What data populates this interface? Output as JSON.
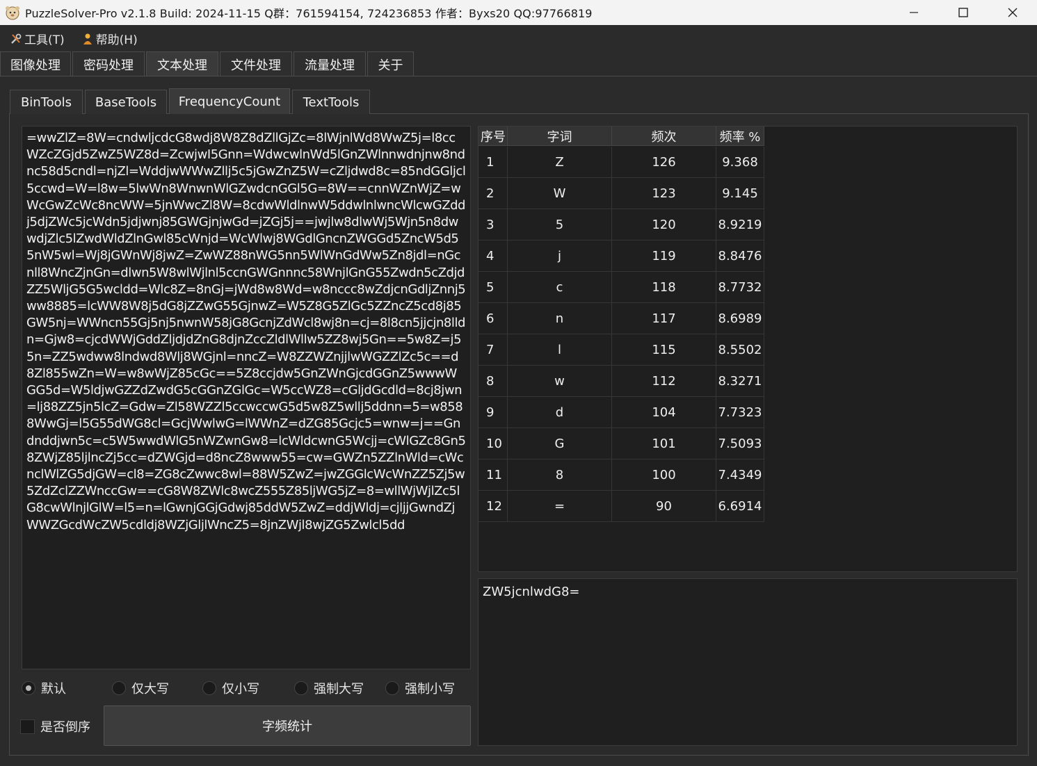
{
  "window": {
    "title": "PuzzleSolver-Pro v2.1.8  Build: 2024-11-15  Q群：761594154, 724236853  作者：Byxs20  QQ:97766819"
  },
  "menu": [
    {
      "label": "工具(T)",
      "icon": "tools-icon"
    },
    {
      "label": "帮助(H)",
      "icon": "help-person-icon"
    }
  ],
  "main_tabs": [
    {
      "label": "图像处理",
      "active": false
    },
    {
      "label": "密码处理",
      "active": false
    },
    {
      "label": "文本处理",
      "active": true
    },
    {
      "label": "文件处理",
      "active": false
    },
    {
      "label": "流量处理",
      "active": false
    },
    {
      "label": "关于",
      "active": false
    }
  ],
  "sub_tabs": [
    {
      "label": "BinTools",
      "active": false
    },
    {
      "label": "BaseTools",
      "active": false
    },
    {
      "label": "FrequencyCount",
      "active": true
    },
    {
      "label": "TextTools",
      "active": false
    }
  ],
  "input_text": "=wwZlZ=8W=cndwljcdcG8wdj8W8Z8dZllGjZc=8lWjnlWd8WwZ5j=l8ccWZcZGjd5ZwZ5WZ8d=ZcwjwI5Gnn=WdwcwlnWd5lGnZWlnnwdnjnw8ndnc58d5cndl=njZl=WddjwWWwZllj5c5jGwZnZ5W=cZljdwd8c=85ndGGljcl5ccwd=W=l8w=5lwWn8WnwnWlGZwdcnGGl5G=8W==cnnWZnWjZ=wWcGwZcWc8ncWW=5jnWwcZl8W=8cdwWldlnwW5ddwlnlwncWlcwGZddj5djZWc5jcWdn5jdjwnj85GWGjnjwGd=jZGj5j==jwjlw8dlwWj5Wjn5n8dwwdjZlc5lZwdWldZlnGwl85cWnjd=WcWlwj8WGdlGncnZWGGd5ZncW5d55nW5wl=Wj8jGWnWj8jwZ=ZwWZ88nWG5nn5WlWnGdWw5Zn8jdl=nGcnll8WncZjnGn=dlwn5W8wlWjlnl5ccnGWGnnnc58WnjlGnG55Zwdn5cZdjdZZ5WljG5G5wcldd=Wlc8Z=8nGj=jWd8w8Wd=w8nccc8wZdjcnGdljZnnj5ww8885=lcWW8W8j5dG8jZZwG55GjnwZ=W5Z8G5ZlGc5ZZncZ5cd8j85GW5nj=WWncn55Gj5nj5nwnW58jG8GcnjZdWcl8wj8n=cj=8l8cn5jjcjn8lldn=Gjw8=cjcdWWjGddZljdjdZnG8djnZccZldlWllw5ZZ8wj5Gn==5w8Z=j55n=ZZ5wdww8lndwd8Wlj8WGjnl=nncZ=W8ZZWZnjjlwWGZZlZc5c==d8Zl855wZn=W=w8wWjZ85cGc==5Z8ccjdw5GnZWnGjcdGGnZ5wwwWGG5d=W5ldjwGZZdZwdG5cGGnZGlGc=W5ccWZ8=cGljdGcdld=8cj8jwn=lj88ZZ5jn5lcZ=Gdw=Zl58WZZl5ccwccwG5d5w8Z5wllj5ddnn=5=w8588WwGj=l5G55dWG8cl=GcjWwlwG=lWWnZ=dZG85Gcjc5=wnw=j==Gndnddjwn5c=c5W5wwdWlG5nWZwnGw8=lcWldcwnG5Wcjj=cWlGZc8Gn58ZWjZ85ljlncZj5cc=dZWGjd=d8ncZ8www55=cw=GWZn5ZZlnWld=cWcnclWlZG5djGW=cl8=ZG8cZwwc8wl=88W5ZwZ=jwZGGlcWcWnZZ5Zj5w5ZdZclZZWnccGw==cG8W8ZWlc8wcZ555Z85ljWG5jZ=8=wllWjWjlZc5lG8cwWlnjlGlW=l5=n=lGwnjGGjGdwj85ddW5ZwZ=ddjWldj=cjljjGwndZjWWZGcdWcZW5cdldj8WZjGljlWncZ5=8jnZWjl8wjZG5Zwlcl5dd",
  "radios": [
    {
      "label": "默认",
      "checked": true
    },
    {
      "label": "仅大写",
      "checked": false
    },
    {
      "label": "仅小写",
      "checked": false
    },
    {
      "label": "强制大写",
      "checked": false
    },
    {
      "label": "强制小写",
      "checked": false
    }
  ],
  "checkbox": {
    "label": "是否倒序",
    "checked": false
  },
  "count_button": "字频统计",
  "table": {
    "headers": [
      "序号",
      "字词",
      "频次",
      "频率 %"
    ],
    "rows": [
      [
        "1",
        "Z",
        "126",
        "9.368"
      ],
      [
        "2",
        "W",
        "123",
        "9.145"
      ],
      [
        "3",
        "5",
        "120",
        "8.9219"
      ],
      [
        "4",
        "j",
        "119",
        "8.8476"
      ],
      [
        "5",
        "c",
        "118",
        "8.7732"
      ],
      [
        "6",
        "n",
        "117",
        "8.6989"
      ],
      [
        "7",
        "l",
        "115",
        "8.5502"
      ],
      [
        "8",
        "w",
        "112",
        "8.3271"
      ],
      [
        "9",
        "d",
        "104",
        "7.7323"
      ],
      [
        "10",
        "G",
        "101",
        "7.5093"
      ],
      [
        "11",
        "8",
        "100",
        "7.4349"
      ],
      [
        "12",
        "=",
        "90",
        "6.6914"
      ]
    ]
  },
  "result_text": "ZW5jcnlwdG8="
}
